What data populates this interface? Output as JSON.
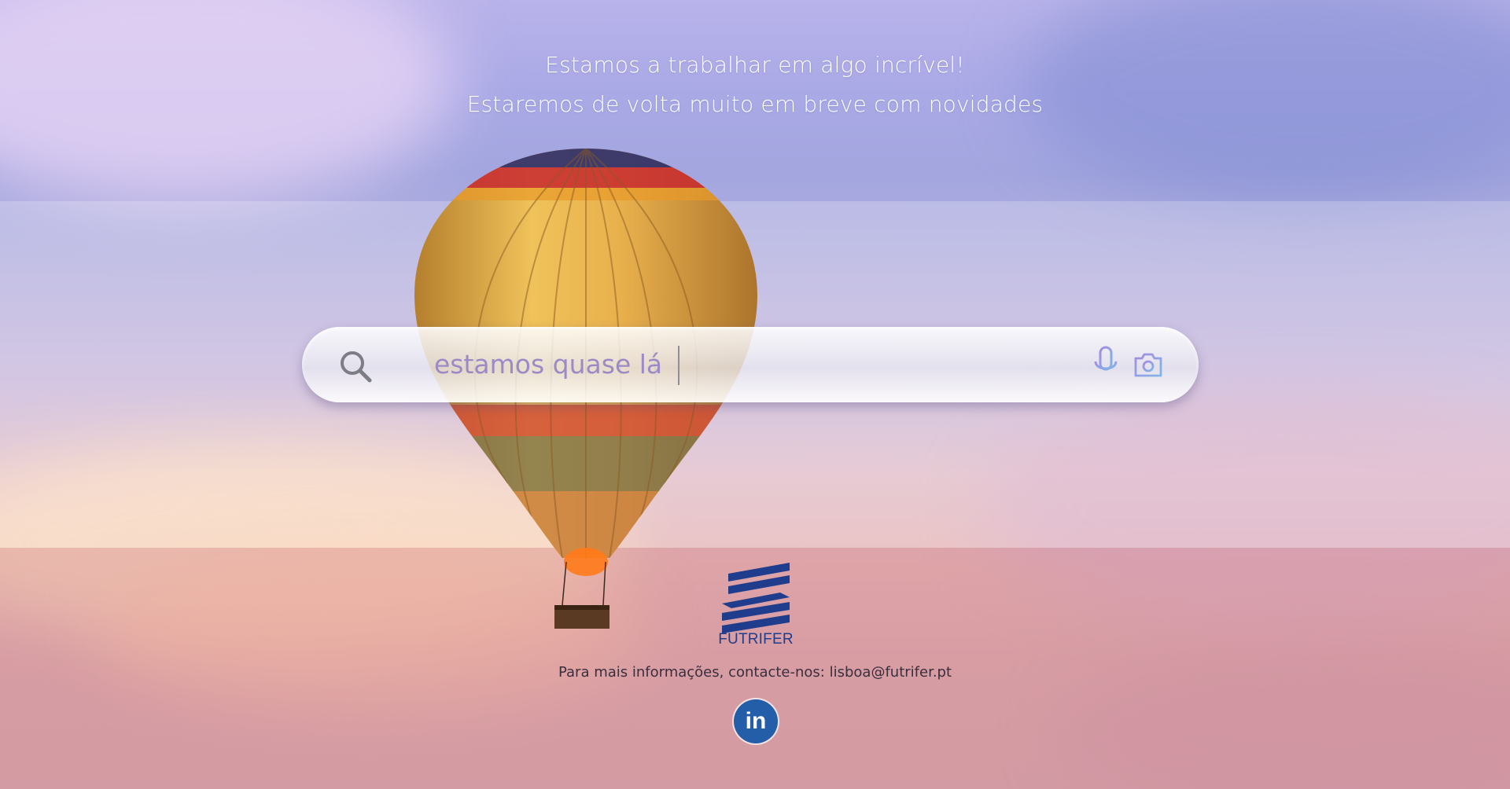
{
  "headline": {
    "line1": "Estamos a trabalhar em algo incrível!",
    "line2": "Estaremos de volta muito em breve com novidades"
  },
  "search": {
    "text": "estamos quase lá",
    "icons": [
      "search-icon",
      "microphone-icon",
      "camera-icon"
    ]
  },
  "brand": {
    "name": "FUTRIFER",
    "color": "#1f3d8c"
  },
  "contact": {
    "prefix": "Para mais informações, contacte-nos:",
    "email": "lisboa@futrifer.pt"
  },
  "social": {
    "linkedin_label": "in",
    "linkedin_color": "#245da8"
  },
  "colors": {
    "search_text": "#9c8ac6",
    "headline_text": "#ffffff"
  }
}
